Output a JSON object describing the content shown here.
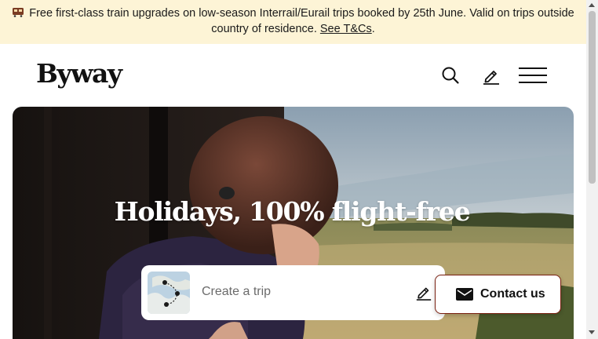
{
  "banner": {
    "text": "Free first-class train upgrades on low-season Interrail/Eurail trips booked by 25th June. Valid on trips outside country of residence.",
    "link": "See T&Cs",
    "suffix": "."
  },
  "header": {
    "logo": "Byway",
    "icons": [
      "search-icon",
      "pencil-icon",
      "menu-icon"
    ]
  },
  "hero": {
    "title": "Holidays, 100% flight-free"
  },
  "trip_search": {
    "placeholder": "Create a trip",
    "icon": "pencil-icon",
    "thumbnail": "route-map-thumbnail"
  },
  "contact": {
    "label": "Contact us",
    "icon": "envelope-icon"
  },
  "colors": {
    "banner_bg": "#fdf4d6",
    "contact_border": "#7a1f10"
  }
}
